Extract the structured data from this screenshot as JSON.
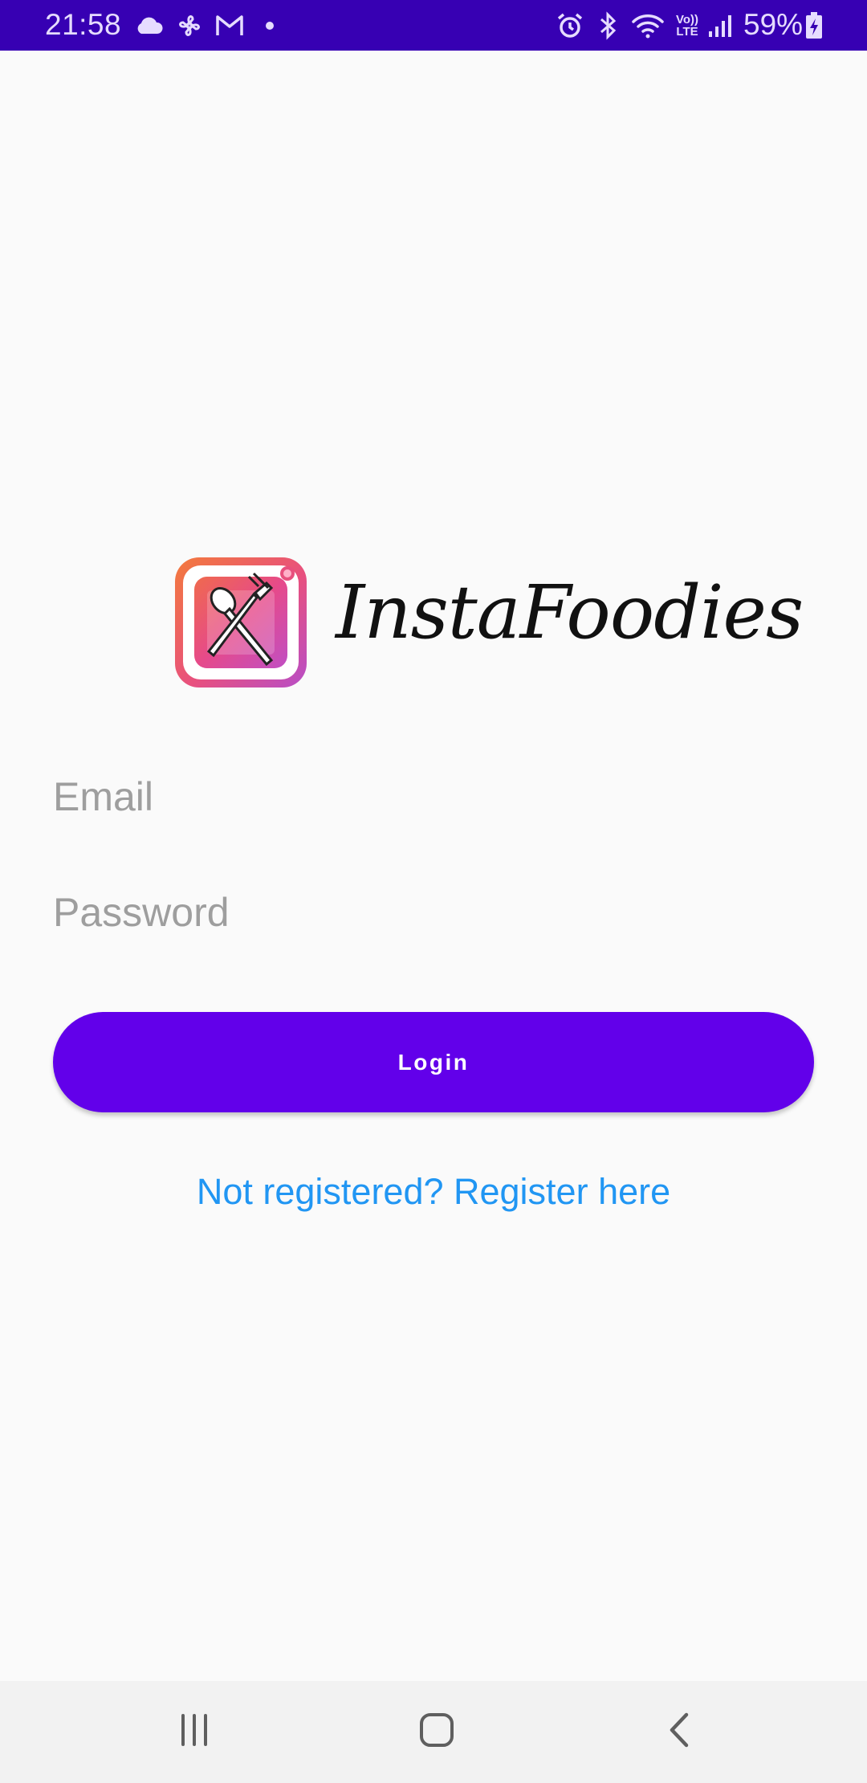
{
  "status_bar": {
    "time": "21:58",
    "left_icons": [
      "cloud-icon",
      "fan-icon",
      "gmail-icon",
      "dot-icon"
    ],
    "right_icons": [
      "alarm-icon",
      "bluetooth-icon",
      "wifi-icon",
      "volte-icon",
      "signal-icon",
      "battery-icon"
    ],
    "volte_label_top": "Vo))",
    "volte_label_bottom": "LTE",
    "battery_text": "59%",
    "background_color": "#3700b3"
  },
  "logo": {
    "brand_name": "InstaFoodies",
    "icon": "plate-cutlery-icon"
  },
  "form": {
    "email_placeholder": "Email",
    "email_value": "",
    "password_placeholder": "Password",
    "password_value": "",
    "login_label": "Login",
    "register_link": "Not registered? Register here"
  },
  "nav_bar": {
    "icons": [
      "recent-apps-icon",
      "home-icon",
      "back-icon"
    ]
  },
  "colors": {
    "accent": "#6200ea",
    "link": "#2196f3",
    "background": "#fafafa"
  }
}
